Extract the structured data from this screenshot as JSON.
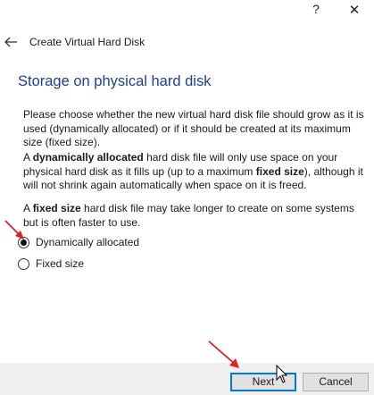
{
  "window": {
    "help_glyph": "?",
    "close_glyph": "✕"
  },
  "header": {
    "back_icon": "back-arrow-icon",
    "title": "Create Virtual Hard Disk"
  },
  "page": {
    "heading": "Storage on physical hard disk",
    "paragraph1": "Please choose whether the new virtual hard disk file should grow as it is used (dynamically allocated) or if it should be created at its maximum size (fixed size).",
    "paragraph2": {
      "pre": "A ",
      "bold1": "dynamically allocated",
      "mid": " hard disk file will only use space on your physical hard disk as it fills up (up to a maximum ",
      "bold2": "fixed size",
      "post": "), although it will not shrink again automatically when space on it is freed."
    },
    "paragraph3": {
      "pre": "A ",
      "bold1": "fixed size",
      "post": " hard disk file may take longer to create on some systems but is often faster to use."
    }
  },
  "options": [
    {
      "label": "Dynamically allocated",
      "selected": true
    },
    {
      "label": "Fixed size",
      "selected": false
    }
  ],
  "footer": {
    "next_label": "Next",
    "cancel_label": "Cancel"
  },
  "colors": {
    "heading": "#1c3f95",
    "focus_border": "#0078d7",
    "annotation_arrow": "#e02020",
    "footer_bg": "#f0f0f0"
  }
}
